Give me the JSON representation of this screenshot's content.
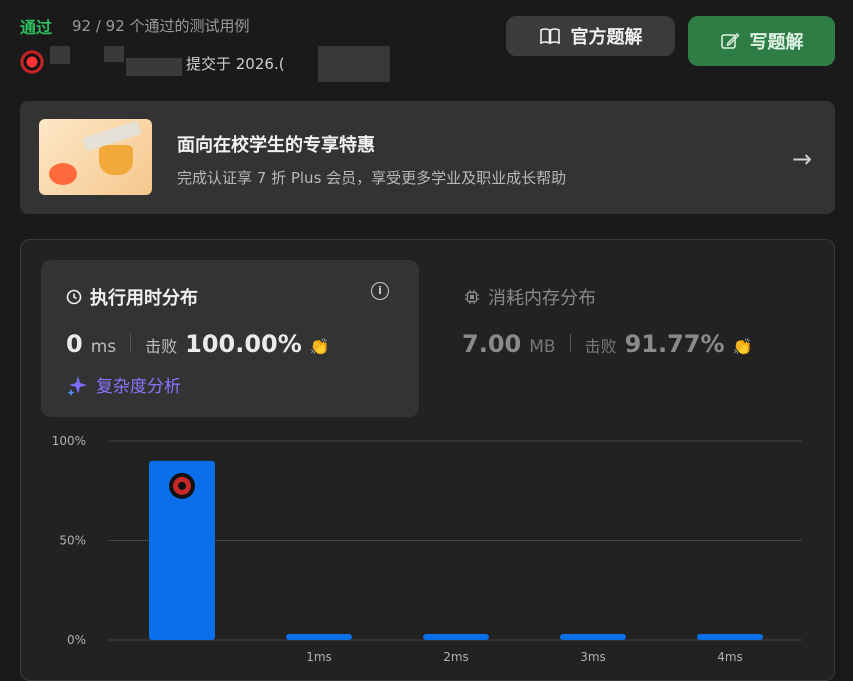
{
  "header": {
    "status": "通过",
    "test_count": "92 / 92 个通过的测试用例",
    "submitted_prefix": "提交于 2026.(",
    "official_solution_label": "官方题解",
    "write_solution_label": "写题解"
  },
  "promo": {
    "title": "面向在校学生的专享特惠",
    "subtitle": "完成认证享 7 折 Plus 会员，享受更多学业及职业成长帮助",
    "arrow": "→"
  },
  "runtime": {
    "title": "执行用时分布",
    "value": "0",
    "unit": "ms",
    "beat_label": "击败",
    "beat_value": "100.00%",
    "complexity_label": "复杂度分析"
  },
  "memory": {
    "title": "消耗内存分布",
    "value": "7.00",
    "unit": "MB",
    "beat_label": "击败",
    "beat_value": "91.77%"
  },
  "colors": {
    "accepted": "#2cbb5d",
    "bar": "#0a6fe8",
    "complexity": "#8a74ff"
  },
  "chart_data": {
    "type": "bar",
    "categories": [
      "0ms",
      "1ms",
      "2ms",
      "3ms",
      "4ms"
    ],
    "tick_labels": [
      "",
      "1ms",
      "2ms",
      "3ms",
      "4ms"
    ],
    "values": [
      90,
      3,
      3,
      3,
      3
    ],
    "ylim": [
      0,
      100
    ],
    "yticks": [
      "0%",
      "50%",
      "100%"
    ],
    "grid": true
  }
}
